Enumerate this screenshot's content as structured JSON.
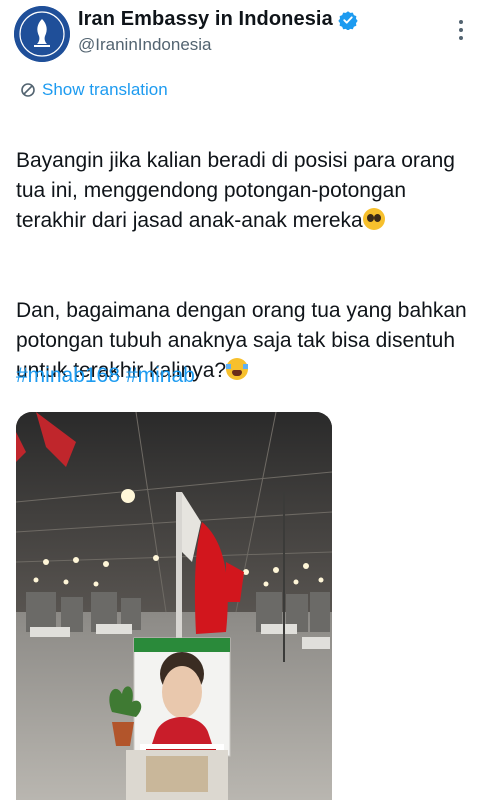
{
  "account": {
    "display_name": "Iran Embassy in Indonesia",
    "handle": "@IraninIndonesia",
    "verified": true,
    "avatar_icon": "embassy-emblem-icon"
  },
  "translate": {
    "label": "Show translation"
  },
  "tweet": {
    "paragraph1": "Bayangin jika kalian beradi di posisi para orang tua ini, menggendong potongan-potongan terakhir dari jasad anak-anak mereka",
    "paragraph2": "Dan, bagaimana dengan orang tua yang bahkan potongan tubuh anaknya saja tak bisa disentuh untuk terakhir kalinya?",
    "hashtags": [
      "#minab168",
      "#minab"
    ]
  },
  "media": {
    "type": "photo",
    "icon": "memorial-photo"
  },
  "colors": {
    "link": "#1d9bf0",
    "text": "#0f1419",
    "secondary": "#536471",
    "verified": "#1d9bf0"
  }
}
